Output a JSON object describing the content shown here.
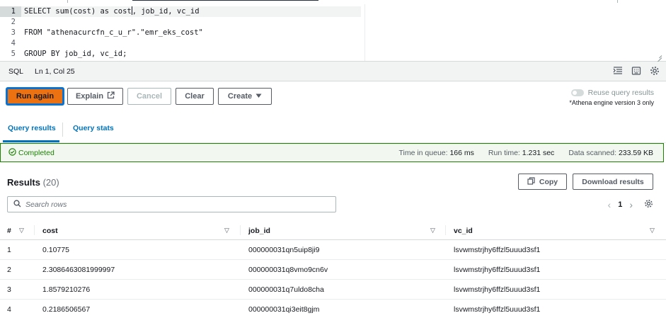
{
  "editor": {
    "lines": [
      {
        "num": "1",
        "before_cursor": "SELECT sum(cost) as cost",
        "after_cursor": ", job_id, vc_id"
      },
      {
        "num": "2",
        "text": ""
      },
      {
        "num": "3",
        "text": "FROM \"athenacurcfn_c_u_r\".\"emr_eks_cost\""
      },
      {
        "num": "4",
        "text": ""
      },
      {
        "num": "5",
        "text": "GROUP BY job_id, vc_id;"
      }
    ]
  },
  "statusbar": {
    "language": "SQL",
    "position": "Ln 1, Col 25"
  },
  "toolbar": {
    "run_again": "Run again",
    "explain": "Explain",
    "cancel": "Cancel",
    "clear": "Clear",
    "create": "Create",
    "reuse_label": "Reuse query results",
    "reuse_note": "*Athena engine version 3 only"
  },
  "tabs": {
    "query_results": "Query results",
    "query_stats": "Query stats"
  },
  "status": {
    "text": "Completed",
    "queue_label": "Time in queue:",
    "queue_value": "166 ms",
    "runtime_label": "Run time:",
    "runtime_value": "1.231 sec",
    "scanned_label": "Data scanned:",
    "scanned_value": "233.59 KB"
  },
  "results": {
    "title": "Results",
    "count": "(20)",
    "copy": "Copy",
    "download": "Download results",
    "search_placeholder": "Search rows",
    "page": "1"
  },
  "table": {
    "columns": [
      "#",
      "cost",
      "job_id",
      "vc_id"
    ],
    "rows": [
      [
        "1",
        "0.10775",
        "000000031qn5uip8ji9",
        "lsvwmstrjhy6ffzl5uuud3sf1"
      ],
      [
        "2",
        "2.3086463081999997",
        "000000031q8vmo9cn6v",
        "lsvwmstrjhy6ffzl5uuud3sf1"
      ],
      [
        "3",
        "1.8579210276",
        "000000031q7uldo8cha",
        "lsvwmstrjhy6ffzl5uuud3sf1"
      ],
      [
        "4",
        "0.2186506567",
        "000000031qi3eit8gjm",
        "lsvwmstrjhy6ffzl5uuud3sf1"
      ]
    ]
  },
  "colors": {
    "primary": "#ec7211",
    "link": "#0073bb",
    "success": "#1d8102"
  },
  "icons": [
    "external-link-icon",
    "caret-down-icon",
    "check-circle-icon",
    "copy-icon",
    "search-icon",
    "gear-icon",
    "format-icon",
    "keyboard-icon",
    "sort-icon"
  ]
}
